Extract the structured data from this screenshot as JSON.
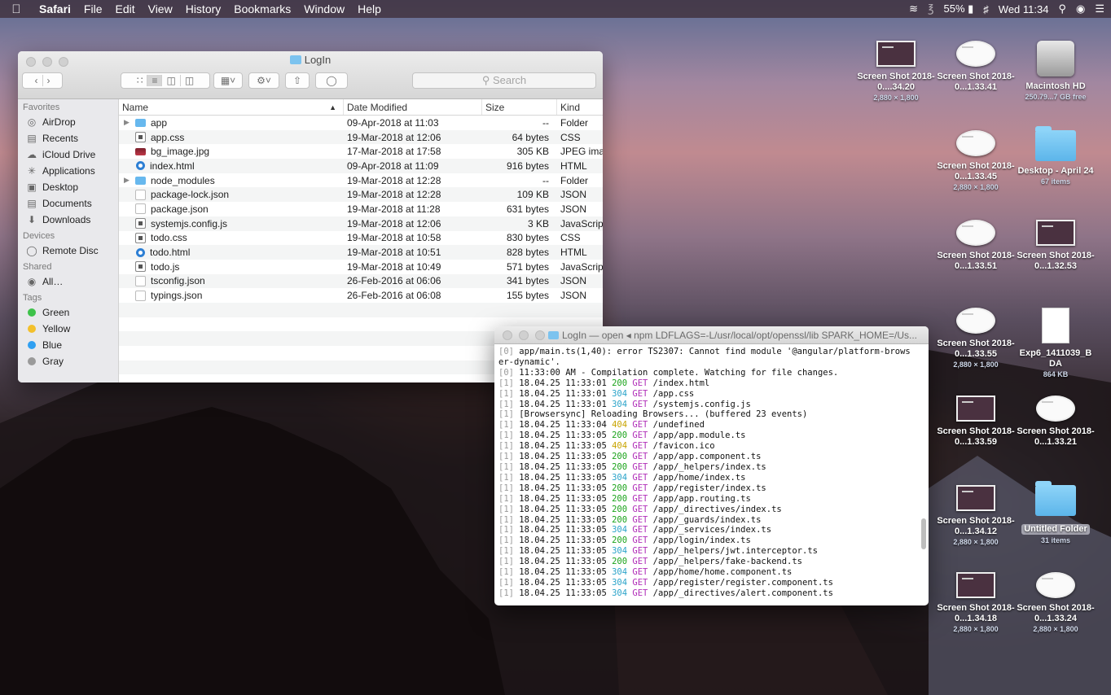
{
  "menubar": {
    "apple_icon": "apple-logo",
    "items": [
      "Safari",
      "File",
      "Edit",
      "View",
      "History",
      "Bookmarks",
      "Window",
      "Help"
    ],
    "battery": "55%",
    "clock": "Wed 11:34"
  },
  "finder": {
    "title": "LogIn",
    "search_placeholder": "Search",
    "sidebar": {
      "favorites_head": "Favorites",
      "favorites": [
        "AirDrop",
        "Recents",
        "iCloud Drive",
        "Applications",
        "Desktop",
        "Documents",
        "Downloads"
      ],
      "devices_head": "Devices",
      "devices": [
        "Remote Disc"
      ],
      "shared_head": "Shared",
      "shared": [
        "All…"
      ],
      "tags_head": "Tags",
      "tags": [
        {
          "label": "Green",
          "color": "#3ec24a"
        },
        {
          "label": "Yellow",
          "color": "#f3c02c"
        },
        {
          "label": "Blue",
          "color": "#2f9ff1"
        },
        {
          "label": "Gray",
          "color": "#9a9a9a"
        }
      ]
    },
    "columns": {
      "name": "Name",
      "date": "Date Modified",
      "size": "Size",
      "kind": "Kind"
    },
    "files": [
      {
        "name": "app",
        "date": "09-Apr-2018 at 11:03",
        "size": "--",
        "kind": "Folder",
        "icon": "folder"
      },
      {
        "name": "app.css",
        "date": "19-Mar-2018 at 12:06",
        "size": "64 bytes",
        "kind": "CSS",
        "icon": "code"
      },
      {
        "name": "bg_image.jpg",
        "date": "17-Mar-2018 at 17:58",
        "size": "305 KB",
        "kind": "JPEG ima",
        "icon": "img"
      },
      {
        "name": "index.html",
        "date": "09-Apr-2018 at 11:09",
        "size": "916 bytes",
        "kind": "HTML",
        "icon": "html"
      },
      {
        "name": "node_modules",
        "date": "19-Mar-2018 at 12:28",
        "size": "--",
        "kind": "Folder",
        "icon": "folder"
      },
      {
        "name": "package-lock.json",
        "date": "19-Mar-2018 at 12:28",
        "size": "109 KB",
        "kind": "JSON",
        "icon": "doc"
      },
      {
        "name": "package.json",
        "date": "19-Mar-2018 at 11:28",
        "size": "631 bytes",
        "kind": "JSON",
        "icon": "doc"
      },
      {
        "name": "systemjs.config.js",
        "date": "19-Mar-2018 at 12:06",
        "size": "3 KB",
        "kind": "JavaScrip",
        "icon": "code"
      },
      {
        "name": "todo.css",
        "date": "19-Mar-2018 at 10:58",
        "size": "830 bytes",
        "kind": "CSS",
        "icon": "code"
      },
      {
        "name": "todo.html",
        "date": "19-Mar-2018 at 10:51",
        "size": "828 bytes",
        "kind": "HTML",
        "icon": "html"
      },
      {
        "name": "todo.js",
        "date": "19-Mar-2018 at 10:49",
        "size": "571 bytes",
        "kind": "JavaScrip",
        "icon": "code"
      },
      {
        "name": "tsconfig.json",
        "date": "26-Feb-2016 at 06:06",
        "size": "341 bytes",
        "kind": "JSON",
        "icon": "doc"
      },
      {
        "name": "typings.json",
        "date": "26-Feb-2016 at 06:08",
        "size": "155 bytes",
        "kind": "JSON",
        "icon": "doc"
      }
    ]
  },
  "terminal": {
    "title": "LogIn — open ◂ npm LDFLAGS=-L/usr/local/opt/openssl/lib SPARK_HOME=/Us...",
    "lines": [
      {
        "pfx": "[0] ",
        "text": "app/main.ts(1,40): error TS2307: Cannot find module '@angular/platform-brows"
      },
      {
        "pfx": "",
        "text": "er-dynamic'."
      },
      {
        "pfx": "[0] ",
        "text": "11:33:00 AM - Compilation complete. Watching for file changes."
      },
      {
        "pfx": "[1] ",
        "ts": "18.04.25 11:33:01",
        "status": "200",
        "path": "/index.html"
      },
      {
        "pfx": "[1] ",
        "ts": "18.04.25 11:33:01",
        "status": "304",
        "path": "/app.css"
      },
      {
        "pfx": "[1] ",
        "ts": "18.04.25 11:33:01",
        "status": "304",
        "path": "/systemjs.config.js"
      },
      {
        "pfx": "[1] ",
        "text": "[Browsersync] Reloading Browsers... (buffered 23 events)"
      },
      {
        "pfx": "[1] ",
        "ts": "18.04.25 11:33:04",
        "status": "404",
        "path": "/undefined"
      },
      {
        "pfx": "[1] ",
        "ts": "18.04.25 11:33:05",
        "status": "200",
        "path": "/app/app.module.ts"
      },
      {
        "pfx": "[1] ",
        "ts": "18.04.25 11:33:05",
        "status": "404",
        "path": "/favicon.ico"
      },
      {
        "pfx": "[1] ",
        "ts": "18.04.25 11:33:05",
        "status": "200",
        "path": "/app/app.component.ts"
      },
      {
        "pfx": "[1] ",
        "ts": "18.04.25 11:33:05",
        "status": "200",
        "path": "/app/_helpers/index.ts"
      },
      {
        "pfx": "[1] ",
        "ts": "18.04.25 11:33:05",
        "status": "304",
        "path": "/app/home/index.ts"
      },
      {
        "pfx": "[1] ",
        "ts": "18.04.25 11:33:05",
        "status": "200",
        "path": "/app/register/index.ts"
      },
      {
        "pfx": "[1] ",
        "ts": "18.04.25 11:33:05",
        "status": "200",
        "path": "/app/app.routing.ts"
      },
      {
        "pfx": "[1] ",
        "ts": "18.04.25 11:33:05",
        "status": "200",
        "path": "/app/_directives/index.ts"
      },
      {
        "pfx": "[1] ",
        "ts": "18.04.25 11:33:05",
        "status": "200",
        "path": "/app/_guards/index.ts"
      },
      {
        "pfx": "[1] ",
        "ts": "18.04.25 11:33:05",
        "status": "304",
        "path": "/app/_services/index.ts"
      },
      {
        "pfx": "[1] ",
        "ts": "18.04.25 11:33:05",
        "status": "200",
        "path": "/app/login/index.ts"
      },
      {
        "pfx": "[1] ",
        "ts": "18.04.25 11:33:05",
        "status": "304",
        "path": "/app/_helpers/jwt.interceptor.ts"
      },
      {
        "pfx": "[1] ",
        "ts": "18.04.25 11:33:05",
        "status": "200",
        "path": "/app/_helpers/fake-backend.ts"
      },
      {
        "pfx": "[1] ",
        "ts": "18.04.25 11:33:05",
        "status": "304",
        "path": "/app/home/home.component.ts"
      },
      {
        "pfx": "[1] ",
        "ts": "18.04.25 11:33:05",
        "status": "304",
        "path": "/app/register/register.component.ts"
      },
      {
        "pfx": "[1] ",
        "ts": "18.04.25 11:33:05",
        "status": "304",
        "path": "/app/_directives/alert.component.ts"
      }
    ]
  },
  "desktop": [
    {
      "label": "Screen Shot 2018-0....34.20",
      "sub": "2,880 × 1,800",
      "kind": "shot"
    },
    {
      "label": "Screen Shot 2018-0...1.33.41",
      "sub": "",
      "kind": "shot-light"
    },
    {
      "label": "Macintosh HD",
      "sub": "250.79...7 GB free",
      "kind": "hd"
    },
    {
      "label": "Screen Shot 2018-0...1.33.45",
      "sub": "2,880 × 1,800",
      "kind": "shot-light"
    },
    {
      "label": "Desktop - April 24",
      "sub": "67 items",
      "kind": "folder"
    },
    {
      "label": "Screen Shot 2018-0...1.33.51",
      "sub": "",
      "kind": "shot-light"
    },
    {
      "label": "Screen Shot 2018-0...1.32.53",
      "sub": "",
      "kind": "shot"
    },
    {
      "label": "Screen Shot 2018-0...1.33.55",
      "sub": "2,880 × 1,800",
      "kind": "shot-light"
    },
    {
      "label": "Exp6_1411039_B DA",
      "sub": "864 KB",
      "kind": "docx"
    },
    {
      "label": "Screen Shot 2018-0...1.33.59",
      "sub": "",
      "kind": "shot"
    },
    {
      "label": "Screen Shot 2018-0...1.33.21",
      "sub": "",
      "kind": "shot-light"
    },
    {
      "label": "Screen Shot 2018-0...1.34.12",
      "sub": "2,880 × 1,800",
      "kind": "shot"
    },
    {
      "label": "Untitled Folder",
      "sub": "31 items",
      "kind": "folder"
    },
    {
      "label": "Screen Shot 2018-0...1.34.18",
      "sub": "2,880 × 1,800",
      "kind": "shot"
    },
    {
      "label": "Screen Shot 2018-0...1.33.24",
      "sub": "2,880 × 1,800",
      "kind": "shot-light"
    }
  ]
}
